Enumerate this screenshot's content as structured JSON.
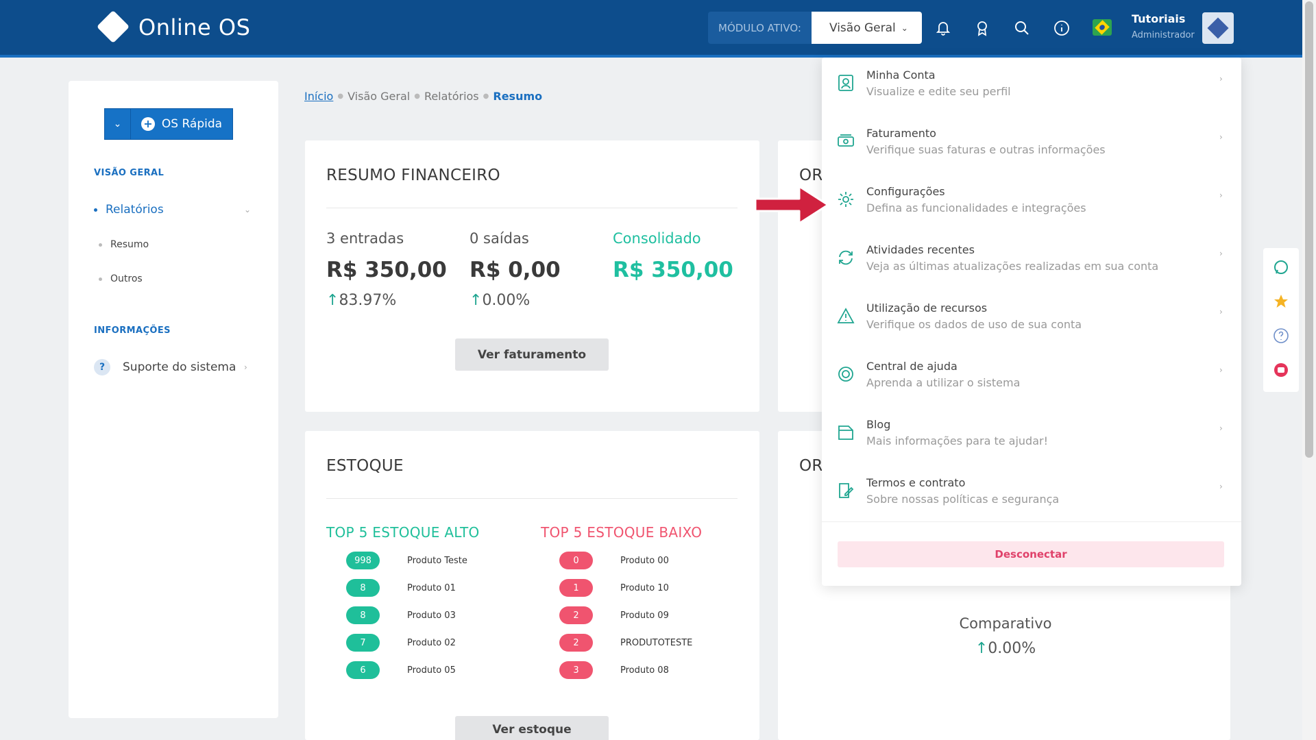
{
  "header": {
    "logo_text": "Online OS",
    "modulo_label": "MÓDULO ATIVO:",
    "modulo_value": "Visão Geral",
    "user_name": "Tutoriais",
    "user_role": "Administrador",
    "icons": [
      "bell-icon",
      "badge-icon",
      "search-icon",
      "info-icon",
      "brazil-flag-icon"
    ]
  },
  "sidebar": {
    "quick_button": "OS Rápida",
    "section1": "VISÃO GERAL",
    "relatorios": "Relatórios",
    "sub_items": [
      "Resumo",
      "Outros"
    ],
    "section2": "INFORMAÇÕES",
    "support": "Suporte do sistema"
  },
  "breadcrumb": {
    "items": [
      "Início",
      "Visão Geral",
      "Relatórios",
      "Resumo"
    ]
  },
  "financeiro": {
    "title": "RESUMO FINANCEIRO",
    "columns": [
      {
        "label": "3 entradas",
        "value": "R$ 350,00",
        "pct": "83.97%"
      },
      {
        "label": "0 saídas",
        "value": "R$ 0,00",
        "pct": "0.00%"
      },
      {
        "label": "Consolidado",
        "value": "R$ 350,00"
      }
    ],
    "button": "Ver faturamento"
  },
  "right_card_title_1": "OR",
  "right_card_title_2": "OR",
  "estoque": {
    "title": "ESTOQUE",
    "alto_title": "TOP 5 ESTOQUE ALTO",
    "baixo_title": "TOP 5 ESTOQUE BAIXO",
    "alto": [
      {
        "qty": "998",
        "name": "Produto Teste"
      },
      {
        "qty": "8",
        "name": "Produto 01"
      },
      {
        "qty": "8",
        "name": "Produto 03"
      },
      {
        "qty": "7",
        "name": "Produto 02"
      },
      {
        "qty": "6",
        "name": "Produto 05"
      }
    ],
    "baixo": [
      {
        "qty": "0",
        "name": "Produto 00"
      },
      {
        "qty": "1",
        "name": "Produto 10"
      },
      {
        "qty": "2",
        "name": "Produto 09"
      },
      {
        "qty": "2",
        "name": "PRODUTOTESTE"
      },
      {
        "qty": "3",
        "name": "Produto 08"
      }
    ],
    "button": "Ver estoque"
  },
  "comparativo": {
    "label": "Comparativo",
    "pct": "0.00%"
  },
  "dropdown": {
    "items": [
      {
        "title": "Minha Conta",
        "sub": "Visualize e edite seu perfil",
        "icon": "profile-icon"
      },
      {
        "title": "Faturamento",
        "sub": "Verifique suas faturas e outras informações",
        "icon": "money-icon"
      },
      {
        "title": "Configurações",
        "sub": "Defina as funcionalidades e integrações",
        "icon": "gear-icon"
      },
      {
        "title": "Atividades recentes",
        "sub": "Veja as últimas atualizações realizadas em sua conta",
        "icon": "refresh-icon"
      },
      {
        "title": "Utilização de recursos",
        "sub": "Verifique os dados de uso de sua conta",
        "icon": "warning-icon"
      },
      {
        "title": "Central de ajuda",
        "sub": "Aprenda a utilizar o sistema",
        "icon": "lifebuoy-icon"
      },
      {
        "title": "Blog",
        "sub": "Mais informações para te ajudar!",
        "icon": "blog-icon"
      },
      {
        "title": "Termos e contrato",
        "sub": "Sobre nossas políticas e segurança",
        "icon": "contract-icon"
      }
    ],
    "logout": "Desconectar"
  },
  "floating_icons": [
    "whatsapp-icon",
    "star-icon",
    "help-icon",
    "youtube-icon"
  ],
  "colors": {
    "header_bg": "#0d4d8c",
    "accent": "#1a6fc0",
    "teal": "#1fbf9a",
    "red": "#f0546f",
    "arrow": "#d0213f"
  }
}
